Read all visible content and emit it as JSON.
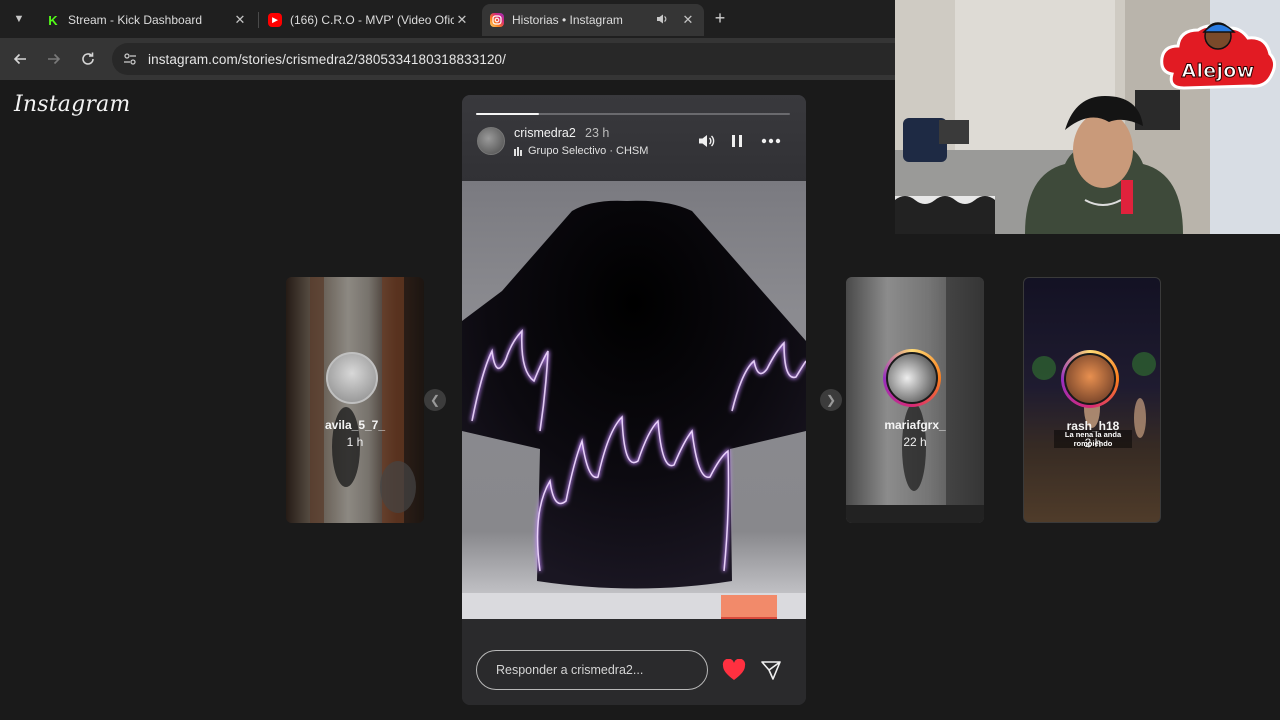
{
  "browser": {
    "tabs": [
      {
        "title": "Stream - Kick Dashboard",
        "favicon": "kick-icon",
        "active": false
      },
      {
        "title": "(166) C.R.O - MVP' (Video Ofici",
        "favicon": "youtube-icon",
        "active": false
      },
      {
        "title": "Historias • Instagram",
        "favicon": "instagram-icon",
        "active": true
      }
    ],
    "url": "instagram.com/stories/crismedra2/3805334180318833120/"
  },
  "instagram": {
    "logo": "Instagram",
    "main_story": {
      "username": "crismedra2",
      "time_ago": "23 h",
      "music": "Grupo Selectivo · CHSM",
      "progress_percent": 20,
      "reply_placeholder": "Responder a crismedra2..."
    },
    "side_stories": [
      {
        "username": "avila_5_7_",
        "time_ago": "1 h"
      },
      {
        "username": "mariafgrx_",
        "time_ago": "22 h"
      },
      {
        "username": "rash_h18",
        "time_ago": "2 h",
        "overlay_text": "La nena la anda rompiendo"
      }
    ]
  },
  "webcam": {
    "badge_label": "Alejow"
  },
  "colors": {
    "flame": "#b45cff",
    "heart": "#ff3040",
    "ring_start": "#feda75",
    "ring_end": "#d62976"
  }
}
